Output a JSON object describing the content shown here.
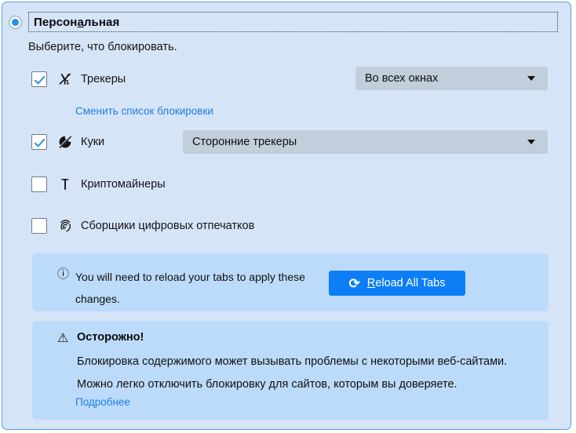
{
  "panel": {
    "radio": {
      "label_before": "Персон",
      "label_accesskey": "а",
      "label_after": "льная",
      "checked": true
    },
    "subtitle": "Выберите, что блокировать.",
    "options": [
      {
        "id": "trackers",
        "label": "Трекеры",
        "icon": "tracker-blocked-icon",
        "checked": true,
        "dropdown": {
          "value": "Во всех окнах"
        }
      },
      {
        "id": "cookies",
        "label": "Куки",
        "icon": "cookie-blocked-icon",
        "checked": true,
        "dropdown": {
          "value": "Сторонние трекеры"
        }
      },
      {
        "id": "cryptominers",
        "label": "Криптомайнеры",
        "icon": "pickaxe-icon",
        "checked": false
      },
      {
        "id": "fingerprinters",
        "label": "Сборщики цифровых отпечатков",
        "icon": "fingerprint-icon",
        "checked": false
      }
    ],
    "change_blocklist_link": "Сменить список блокировки",
    "info": {
      "icon": "info-circle-icon",
      "message": "You will need to reload your tabs to apply these changes.",
      "button": {
        "icon": "reload-icon",
        "accesskey": "R",
        "label_rest": "eload All Tabs"
      }
    },
    "warning": {
      "icon": "warning-triangle-icon",
      "title": "Осторожно!",
      "body": "Блокировка содержимого может вызывать проблемы с некоторыми веб-сайтами. Можно легко отключить блокировку для сайтов, которым вы доверяете.",
      "link": "Подробнее"
    }
  },
  "colors": {
    "page_background": "#d6e4f8",
    "panel_border": "#54a0e0",
    "box_background": "#bcdbfa",
    "dropdown_background": "#c2cedb",
    "accent_button": "#0d7ef5",
    "link": "#1e7fe0",
    "radio_dot": "#2c92e4",
    "checkbox_check": "#2f8fdd"
  }
}
